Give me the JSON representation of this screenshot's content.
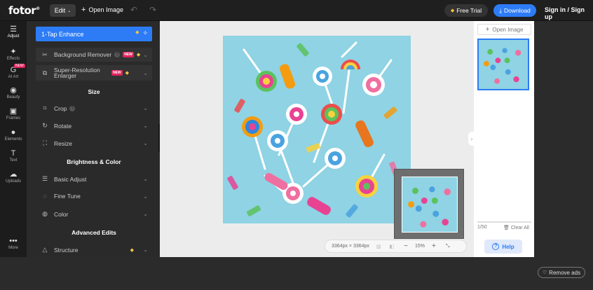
{
  "topbar": {
    "logo": "fotor",
    "logo_mark": "®",
    "edit_label": "Edit",
    "open_image": "Open Image",
    "free_trial": "Free Trial",
    "download": "Download",
    "signin": "Sign in / Sign up"
  },
  "iconbar": {
    "items": [
      {
        "icon": "adjust-icon",
        "label": "Adjust",
        "glyph": "☰"
      },
      {
        "icon": "effects-icon",
        "label": "Effects",
        "glyph": "✦"
      },
      {
        "icon": "ai-art-icon",
        "label": "AI Art",
        "glyph": "G",
        "tag": "NEW"
      },
      {
        "icon": "beauty-icon",
        "label": "Beauty",
        "glyph": "◉"
      },
      {
        "icon": "frames-icon",
        "label": "Frames",
        "glyph": "▣"
      },
      {
        "icon": "elements-icon",
        "label": "Elements",
        "glyph": "●"
      },
      {
        "icon": "text-icon",
        "label": "Text",
        "glyph": "T"
      },
      {
        "icon": "uploads-icon",
        "label": "Uploads",
        "glyph": "☁"
      },
      {
        "icon": "more-icon",
        "label": "More",
        "glyph": "•••"
      }
    ]
  },
  "panel": {
    "one_tap": "1-Tap Enhance",
    "bg_remover": "Background Remover",
    "super_res": "Super-Resolution Enlarger",
    "new_tag": "NEW",
    "size_title": "Size",
    "crop": "Crop",
    "rotate": "Rotate",
    "resize": "Resize",
    "brightness_title": "Brightness & Color",
    "basic_adjust": "Basic Adjust",
    "fine_tune": "Fine Tune",
    "color": "Color",
    "advanced_title": "Advanced Edits",
    "structure": "Structure"
  },
  "canvas": {
    "dimensions": "3364px × 3364px",
    "zoom": "15%"
  },
  "rightpanel": {
    "open_image": "Open Image",
    "page_count": "1/50",
    "clear_all": "Clear All",
    "help": "Help"
  },
  "footer": {
    "remove_ads": "Remove ads"
  },
  "colors": {
    "accent": "#2d7cf6",
    "photo_bg": "#8fd3e4",
    "new_pill": "#e0245e",
    "diamond": "#f5c542"
  }
}
